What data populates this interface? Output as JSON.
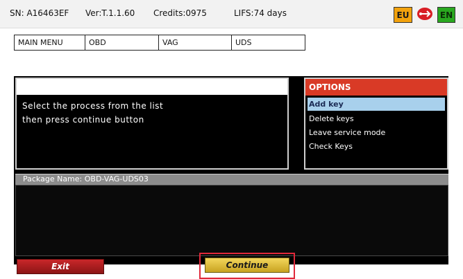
{
  "status": {
    "sn": "SN: A16463EF",
    "ver": "Ver:T.1.1.60",
    "credits": "Credits:0975",
    "lifs": "LIFS:74 days",
    "region_badge": "EU",
    "language_badge": "EN",
    "usb_icon": "usb-icon",
    "colors": {
      "eu": "#f2a20d",
      "en": "#29a81f",
      "usb": "#d81e25"
    }
  },
  "breadcrumb": [
    "MAIN MENU",
    "OBD",
    "VAG",
    "UDS"
  ],
  "instructions": {
    "line1": "Select the process from the list",
    "line2": "then press continue button"
  },
  "options": {
    "title": "OPTIONS",
    "items": [
      "Add key",
      "Delete keys",
      "Leave service mode",
      "Check Keys"
    ],
    "selected": "Add key",
    "header_color": "#d93a26",
    "selected_color": "#a8d0ec"
  },
  "package": {
    "label": "Package Name: OBD-VAG-UDS03"
  },
  "buttons": {
    "exit": "Exit",
    "continue": "Continue",
    "exit_color": "#c9272a",
    "continue_color": "#f2d65c",
    "highlight_color": "#e0283a"
  }
}
